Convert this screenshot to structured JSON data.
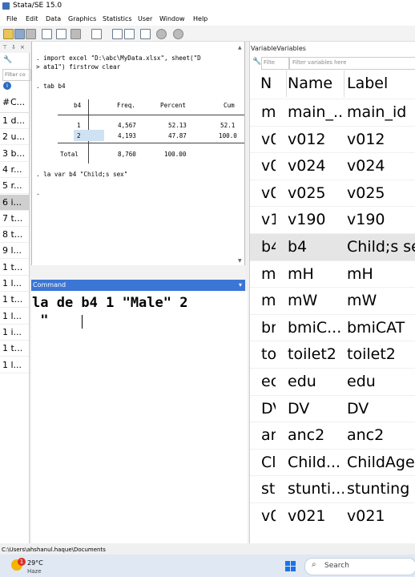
{
  "window": {
    "title": "Stata/SE 15.0"
  },
  "menu": [
    "File",
    "Edit",
    "Data",
    "Graphics",
    "Statistics",
    "User",
    "Window",
    "Help"
  ],
  "history": {
    "search_placeholder": "Filter co",
    "col_num": "#",
    "col_cmd": "C...",
    "items": [
      "1 d...",
      "2 u...",
      "3 b...",
      "4 r...",
      "5 r...",
      "6 i...",
      "7 t...",
      "8 t...",
      "9 l...",
      "1 t...",
      "1 l...",
      "1 t...",
      "1 l...",
      "1 i...",
      "1 t...",
      "1 l..."
    ],
    "selected_index": 5
  },
  "results": {
    "line1": ". import excel \"D:\\abc\\MyData.xlsx\", sheet(\"D",
    "line2": "> ata1\") firstrow clear",
    "line3": ". tab b4",
    "table_var": "b4",
    "table_headers": [
      "Freq.",
      "Percent",
      "Cum"
    ],
    "rows": [
      {
        "val": "1",
        "freq": "4,567",
        "pct": "52.13",
        "cum": "52.1"
      },
      {
        "val": "2",
        "freq": "4,193",
        "pct": "47.87",
        "cum": "100.0"
      }
    ],
    "total_label": "Total",
    "total_freq": "8,760",
    "total_pct": "100.00",
    "line4": ". la var b4 \"Child;s sex\"",
    "line5": "."
  },
  "command": {
    "header": "Command",
    "line1": "la de b4 1 \"Male\" 2",
    "line2": " \""
  },
  "variables": {
    "header": "VariableVariables",
    "search_placeholder": "Filte",
    "filter_placeholder": "Filter variables here",
    "col_n": "N",
    "col_name": "Name",
    "col_label": "Label",
    "rows": [
      {
        "n": "m",
        "name": "main_...",
        "label": "main_id"
      },
      {
        "n": "v0",
        "name": "v012",
        "label": "v012"
      },
      {
        "n": "v0",
        "name": "v024",
        "label": "v024"
      },
      {
        "n": "v0",
        "name": "v025",
        "label": "v025"
      },
      {
        "n": "v1",
        "name": "v190",
        "label": "v190"
      },
      {
        "n": "b4",
        "name": "b4",
        "label": "Child;s sex"
      },
      {
        "n": "m",
        "name": "mH",
        "label": "mH"
      },
      {
        "n": "m",
        "name": "mW",
        "label": "mW"
      },
      {
        "n": "br",
        "name": "bmiC...",
        "label": "bmiCAT"
      },
      {
        "n": "to",
        "name": "toilet2",
        "label": "toilet2"
      },
      {
        "n": "ec",
        "name": "edu",
        "label": "edu"
      },
      {
        "n": "DV",
        "name": "DV",
        "label": "DV"
      },
      {
        "n": "ar",
        "name": "anc2",
        "label": "anc2"
      },
      {
        "n": "Cl",
        "name": "Child...",
        "label": "ChildAge"
      },
      {
        "n": "st",
        "name": "stunti...",
        "label": "stunting"
      },
      {
        "n": "v0",
        "name": "v021",
        "label": "v021"
      }
    ],
    "selected_index": 5
  },
  "statusbar": {
    "path": "C:\\Users\\ahshanul.haque\\Documents"
  },
  "taskbar": {
    "temp": "29°C",
    "weather": "Haze",
    "notification_count": "1",
    "search": "Search"
  },
  "colors": {
    "accent": "#3b76d6",
    "selection": "#cfcfcf"
  }
}
